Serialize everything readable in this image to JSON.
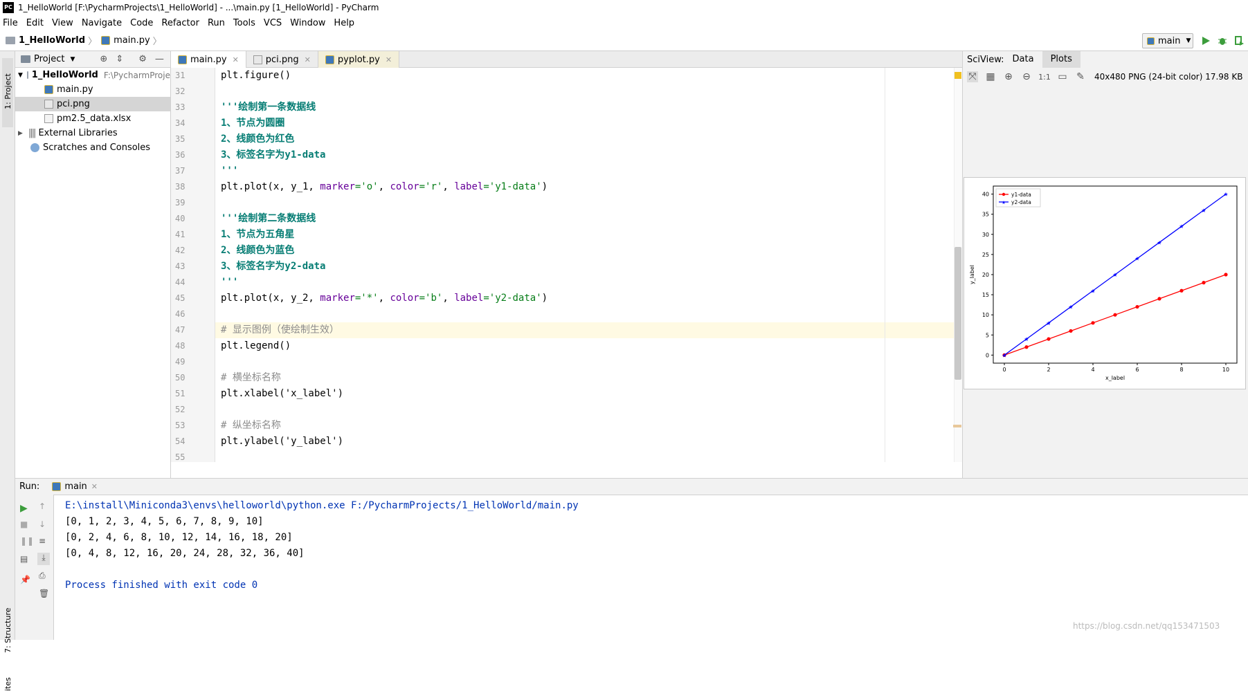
{
  "window": {
    "title": "1_HelloWorld [F:\\PycharmProjects\\1_HelloWorld] - ...\\main.py [1_HelloWorld] - PyCharm",
    "app_icon_text": "PC"
  },
  "menu": [
    "File",
    "Edit",
    "View",
    "Navigate",
    "Code",
    "Refactor",
    "Run",
    "Tools",
    "VCS",
    "Window",
    "Help"
  ],
  "breadcrumb": {
    "project": "1_HelloWorld",
    "file": "main.py"
  },
  "run_config": "main",
  "left_strip": {
    "project_tab": "1: Project",
    "structure_tab": "7: Structure",
    "favorites_tab": "ites"
  },
  "project": {
    "header": "Project",
    "root_name": "1_HelloWorld",
    "root_path": "F:\\PycharmProje",
    "files": [
      "main.py",
      "pci.png",
      "pm2.5_data.xlsx"
    ],
    "external": "External Libraries",
    "scratches": "Scratches and Consoles"
  },
  "tabs": [
    "main.py",
    "pci.png",
    "pyplot.py"
  ],
  "editor": {
    "line_numbers": [
      "31",
      "32",
      "33",
      "34",
      "35",
      "36",
      "37",
      "38",
      "39",
      "40",
      "41",
      "42",
      "43",
      "44",
      "45",
      "46",
      "47",
      "48",
      "49",
      "50",
      "51",
      "52",
      "53",
      "54",
      "55"
    ],
    "lines": [
      {
        "type": "code",
        "text": "plt.figure()"
      },
      {
        "type": "blank",
        "text": ""
      },
      {
        "type": "doc",
        "text": "'''绘制第一条数据线"
      },
      {
        "type": "doc",
        "text": "1、节点为圆圈"
      },
      {
        "type": "doc",
        "text": "2、线颜色为红色"
      },
      {
        "type": "doc",
        "text": "3、标签名字为y1-data"
      },
      {
        "type": "doc",
        "text": "'''"
      },
      {
        "type": "plot",
        "pre": "plt.plot(x, y_1, ",
        "k1": "marker",
        "v1": "='o'",
        "k2": "color",
        "v2": "='r'",
        "k3": "label",
        "v3": "='y1-data'",
        "post": ")"
      },
      {
        "type": "blank",
        "text": ""
      },
      {
        "type": "doc",
        "text": "'''绘制第二条数据线"
      },
      {
        "type": "doc",
        "text": "1、节点为五角星"
      },
      {
        "type": "doc",
        "text": "2、线颜色为蓝色"
      },
      {
        "type": "doc",
        "text": "3、标签名字为y2-data"
      },
      {
        "type": "doc",
        "text": "'''"
      },
      {
        "type": "plot",
        "pre": "plt.plot(x, y_2, ",
        "k1": "marker",
        "v1": "='*'",
        "k2": "color",
        "v2": "='b'",
        "k3": "label",
        "v3": "='y2-data'",
        "post": ")"
      },
      {
        "type": "blank",
        "text": ""
      },
      {
        "type": "comment",
        "text": "# 显示图例（使绘制生效）"
      },
      {
        "type": "code",
        "text": "plt.legend()"
      },
      {
        "type": "blank",
        "text": ""
      },
      {
        "type": "comment",
        "text": "# 横坐标名称"
      },
      {
        "type": "code",
        "text": "plt.xlabel('x_label')"
      },
      {
        "type": "blank",
        "text": ""
      },
      {
        "type": "comment",
        "text": "# 纵坐标名称"
      },
      {
        "type": "code",
        "text": "plt.ylabel('y_label')"
      },
      {
        "type": "blank",
        "text": ""
      }
    ]
  },
  "sciview": {
    "label": "SciView:",
    "tabs": [
      "Data",
      "Plots"
    ],
    "ratio_label": "1:1",
    "image_info": "40x480 PNG (24-bit color) 17.98 KB"
  },
  "chart_data": {
    "type": "line",
    "xlabel": "x_label",
    "ylabel": "y_label",
    "xlim": [
      -0.5,
      10.5
    ],
    "ylim": [
      -2,
      42
    ],
    "xticks": [
      0,
      2,
      4,
      6,
      8,
      10
    ],
    "yticks": [
      0,
      5,
      10,
      15,
      20,
      25,
      30,
      35,
      40
    ],
    "legend_position": "top-left",
    "x": [
      0,
      1,
      2,
      3,
      4,
      5,
      6,
      7,
      8,
      9,
      10
    ],
    "series": [
      {
        "name": "y1-data",
        "values": [
          0,
          2,
          4,
          6,
          8,
          10,
          12,
          14,
          16,
          18,
          20
        ],
        "color": "#ff0000",
        "marker": "o"
      },
      {
        "name": "y2-data",
        "values": [
          0,
          4,
          8,
          12,
          16,
          20,
          24,
          28,
          32,
          36,
          40
        ],
        "color": "#0000ff",
        "marker": "*"
      }
    ]
  },
  "run": {
    "label": "Run:",
    "tab": "main",
    "output": [
      "E:\\install\\Miniconda3\\envs\\helloworld\\python.exe F:/PycharmProjects/1_HelloWorld/main.py",
      "[0, 1, 2, 3, 4, 5, 6, 7, 8, 9, 10]",
      "[0, 2, 4, 6, 8, 10, 12, 14, 16, 18, 20]",
      "[0, 4, 8, 12, 16, 20, 24, 28, 32, 36, 40]",
      "",
      "Process finished with exit code 0"
    ]
  },
  "watermark": "https://blog.csdn.net/qq153471503",
  "colors": {
    "doc_string": "#067d74",
    "comment": "#8c8c8c",
    "keyword_arg": "#660099",
    "string": "#067d17",
    "console_path": "#0033b3"
  }
}
